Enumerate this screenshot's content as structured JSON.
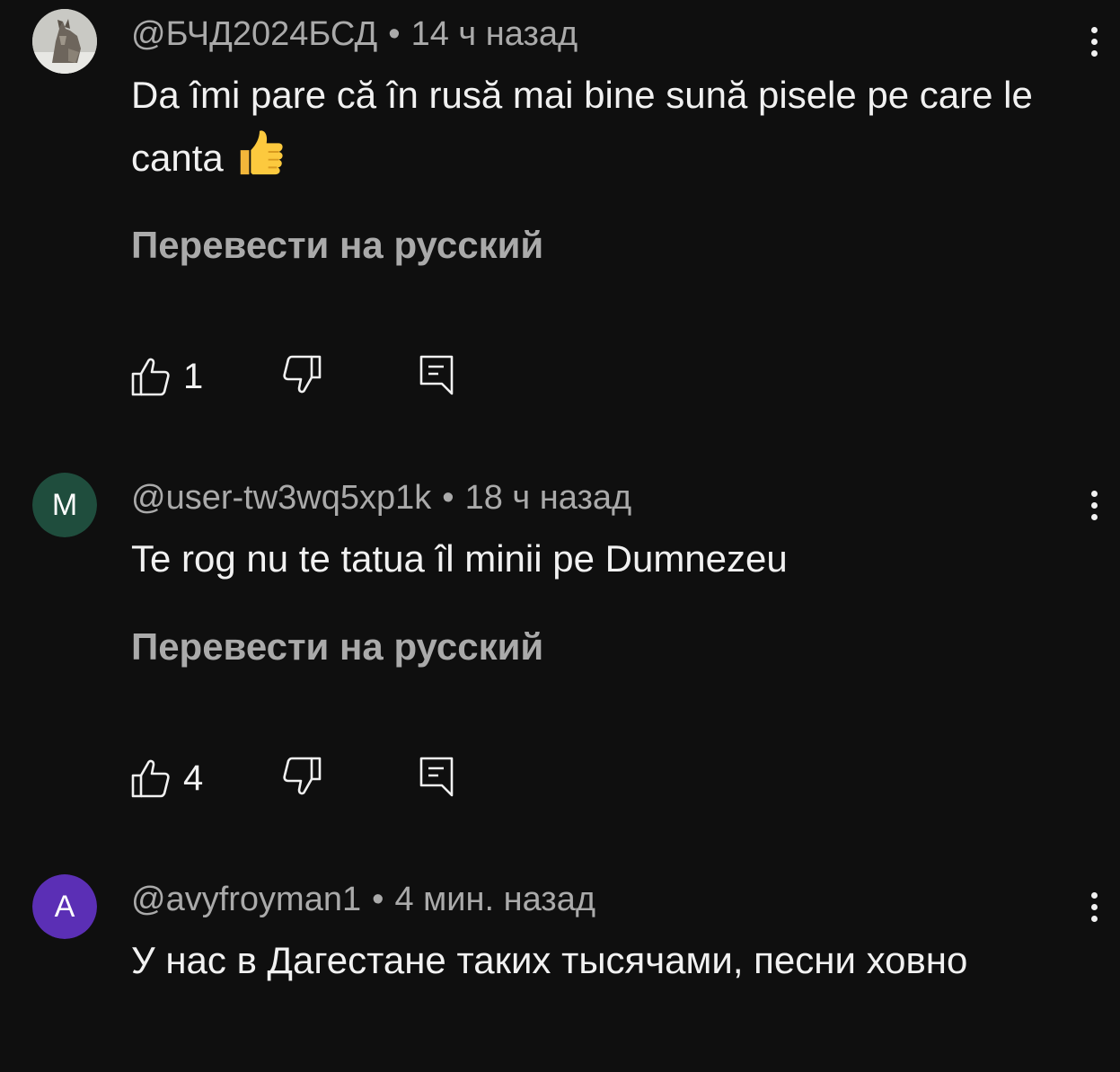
{
  "comments": [
    {
      "author": "@БЧД2024БСД",
      "separator": "•",
      "time": "14 ч назад",
      "text": "Da îmi pare că în rusă mai bine sună pisele pe care le canta",
      "emoji": "thumbs-up",
      "translate": "Перевести на русский",
      "likes": "1",
      "avatar": {
        "type": "image",
        "name": "wolf-avatar"
      }
    },
    {
      "author": "@user-tw3wq5xp1k",
      "separator": "•",
      "time": "18 ч назад",
      "text": "Te rog nu te tatua îl minii  pe Dumnezeu",
      "translate": "Перевести на русский",
      "likes": "4",
      "avatar": {
        "type": "letter",
        "letter": "M",
        "color": "#1f4d3d"
      }
    },
    {
      "author": "@avyfroyman1",
      "separator": "•",
      "time": "4 мин. назад",
      "text": "У нас в Дагестане таких тысячами, песни ховно",
      "avatar": {
        "type": "letter",
        "letter": "A",
        "color": "#5b2fb5"
      }
    }
  ],
  "icons": {
    "like": "thumb-up-outline-icon",
    "dislike": "thumb-down-outline-icon",
    "reply": "reply-comment-icon",
    "menu": "more-vertical-icon"
  },
  "colors": {
    "background": "#0f0f0f",
    "primary_text": "#f1f1f1",
    "secondary_text": "#aaaaaa"
  }
}
